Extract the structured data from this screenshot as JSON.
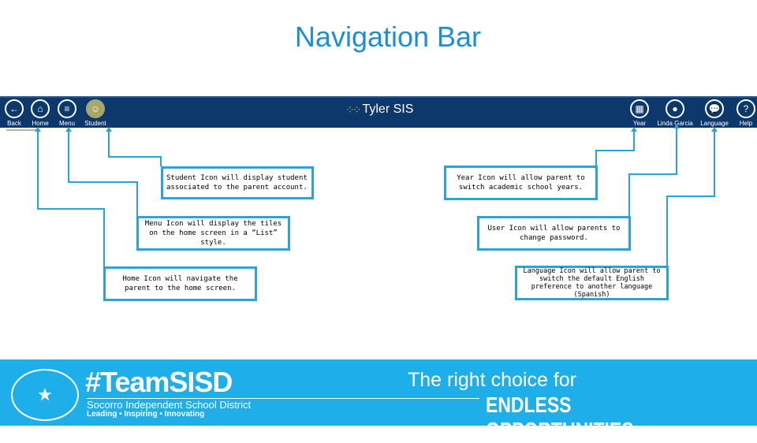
{
  "title": "Navigation Bar",
  "navbar": {
    "app_name": "Tyler SIS",
    "left": [
      {
        "label": "Back",
        "icon": "arrow-left-icon"
      },
      {
        "label": "Home",
        "icon": "home-icon"
      },
      {
        "label": "Menu",
        "icon": "list-icon"
      },
      {
        "label": "Student",
        "icon": "student-icon"
      }
    ],
    "right": [
      {
        "label": "Year",
        "icon": "calendar-icon"
      },
      {
        "label": "Linda Garcia",
        "icon": "user-icon"
      },
      {
        "label": "Language",
        "icon": "speech-bubble-icon"
      },
      {
        "label": "Help",
        "icon": "question-icon"
      }
    ]
  },
  "callouts": {
    "student": "Student Icon will display student associated to the parent account.",
    "menu": "Menu Icon will display the tiles on the home screen in a “List” style.",
    "home": "Home Icon will navigate the parent to the home screen.",
    "year": "Year Icon will allow parent to switch academic school years.",
    "user": "User Icon will allow parents to change password.",
    "language": "Language Icon will allow parent to switch the default English preference to another language (Spanish)"
  },
  "footer": {
    "hashtag": "#TeamSISD",
    "district": "Socorro Independent School District",
    "motto": "Leading • Inspiring • Innovating",
    "tagline1": "The right choice for",
    "tagline2": "ENDLESS OPPORTUNITIES."
  },
  "colors": {
    "accent": "#29a3dc",
    "navbar": "#0d386b",
    "footer": "#1eaeea"
  }
}
